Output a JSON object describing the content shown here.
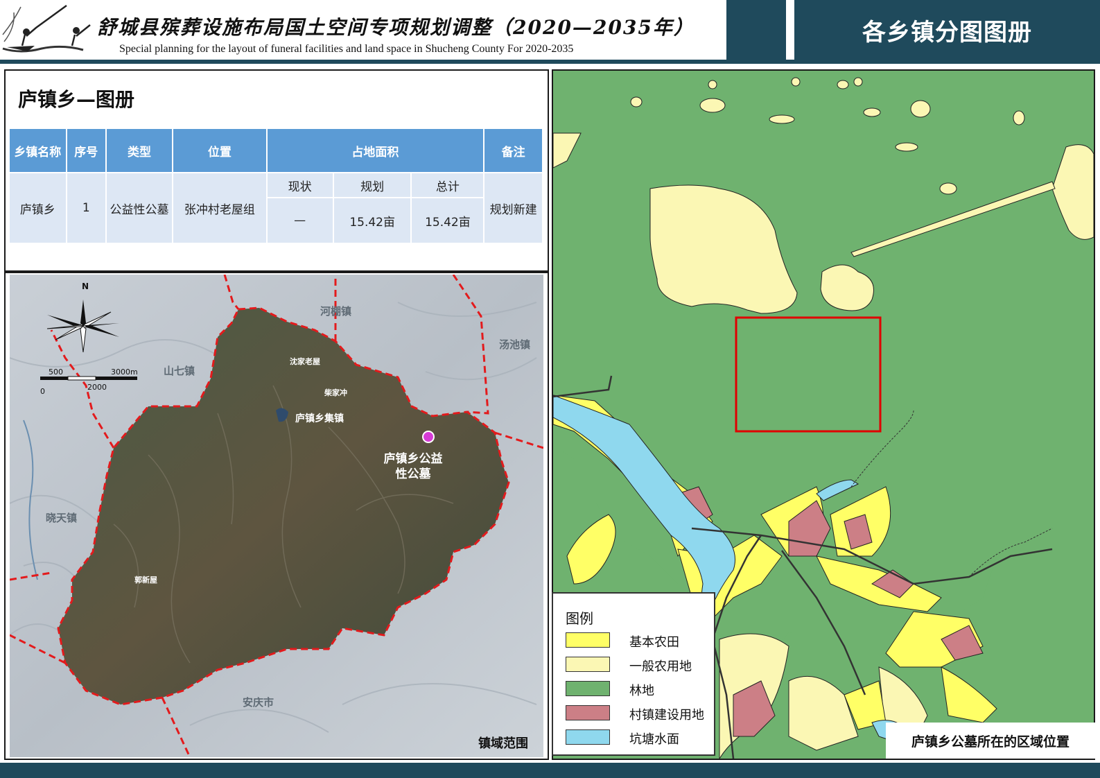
{
  "header": {
    "title_cn": "舒城县殡葬设施布局国土空间专项规划调整（2020—2035年）",
    "title_en": "Special planning for the layout of funeral facilities and land space in Shucheng County For 2020-2035",
    "atlas_title": "各乡镇分图图册"
  },
  "section_title": "庐镇乡—图册",
  "table": {
    "headers": [
      "乡镇名称",
      "序号",
      "类型",
      "位置",
      "占地面积",
      "备注"
    ],
    "area_subheaders": [
      "现状",
      "规划",
      "总计"
    ],
    "rows": [
      {
        "township": "庐镇乡",
        "number": "1",
        "type": "公益性公墓",
        "location": "张冲村老屋组",
        "current": "—",
        "planned": "15.42亩",
        "total": "15.42亩",
        "remark": "规划新建"
      }
    ]
  },
  "satellite_map": {
    "neighbors": [
      "河棚镇",
      "汤池镇",
      "山七镇",
      "晓天镇",
      "安庆市"
    ],
    "places": [
      "沈家老屋",
      "柴家冲",
      "郭新屋"
    ],
    "town_center": "庐镇乡集镇",
    "cemetery_label": "庐镇乡公益性公墓",
    "north_label": "N",
    "scale_labels": [
      "500",
      "3000m",
      "0",
      "2000"
    ],
    "extent_label": "镇域范围",
    "boundary_color": "#e31a1c",
    "cemetery_marker_color": "#d63bd6"
  },
  "landuse_map": {
    "legend_title": "图例",
    "legend": [
      {
        "label": "基本农田",
        "color": "#ffff66"
      },
      {
        "label": "一般农用地",
        "color": "#fbf7b4"
      },
      {
        "label": "林地",
        "color": "#6fb26f"
      },
      {
        "label": "村镇建设用地",
        "color": "#cc7f86"
      },
      {
        "label": "坑塘水面",
        "color": "#8fd8ee"
      }
    ],
    "location_label": "庐镇乡公墓所在的区域位置",
    "highlight_color": "#e00000"
  }
}
